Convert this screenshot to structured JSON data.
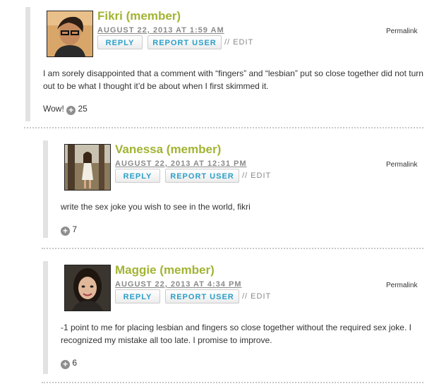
{
  "comments": [
    {
      "author": "Fikri (member)",
      "date": "AUGUST 22, 2013 AT 1:59 AM",
      "reply": "REPLY",
      "report": "REPORT USER",
      "edit": "// EDIT",
      "permalink": "Permalink",
      "text": "I am sorely disappointed that a comment with “fingers” and “lesbian” put so close together did not turn out to be what I thought it’d be about when I first skimmed it.",
      "vote_prefix": "Wow!",
      "votes": "25"
    },
    {
      "author": "Vanessa (member)",
      "date": "AUGUST 22, 2013 AT 12:31 PM",
      "reply": "REPLY",
      "report": "REPORT USER",
      "edit": "// EDIT",
      "permalink": "Permalink",
      "text": "write the sex joke you wish to see in the world, fikri",
      "votes": "7"
    },
    {
      "author": "Maggie (member)",
      "date": "AUGUST 22, 2013 AT 4:34 PM",
      "reply": "REPLY",
      "report": "REPORT USER",
      "edit": "// EDIT",
      "permalink": "Permalink",
      "text": "-1 point to me for placing lesbian and fingers so close together without the required sex joke. I recognized my mistake all too late. I promise to improve.",
      "votes": "6"
    }
  ],
  "colors": {
    "author": "#a2b432",
    "button_text": "#2a9fc9",
    "date": "#8a8a8a"
  },
  "icons": {
    "vote": "plus-circle-icon"
  }
}
